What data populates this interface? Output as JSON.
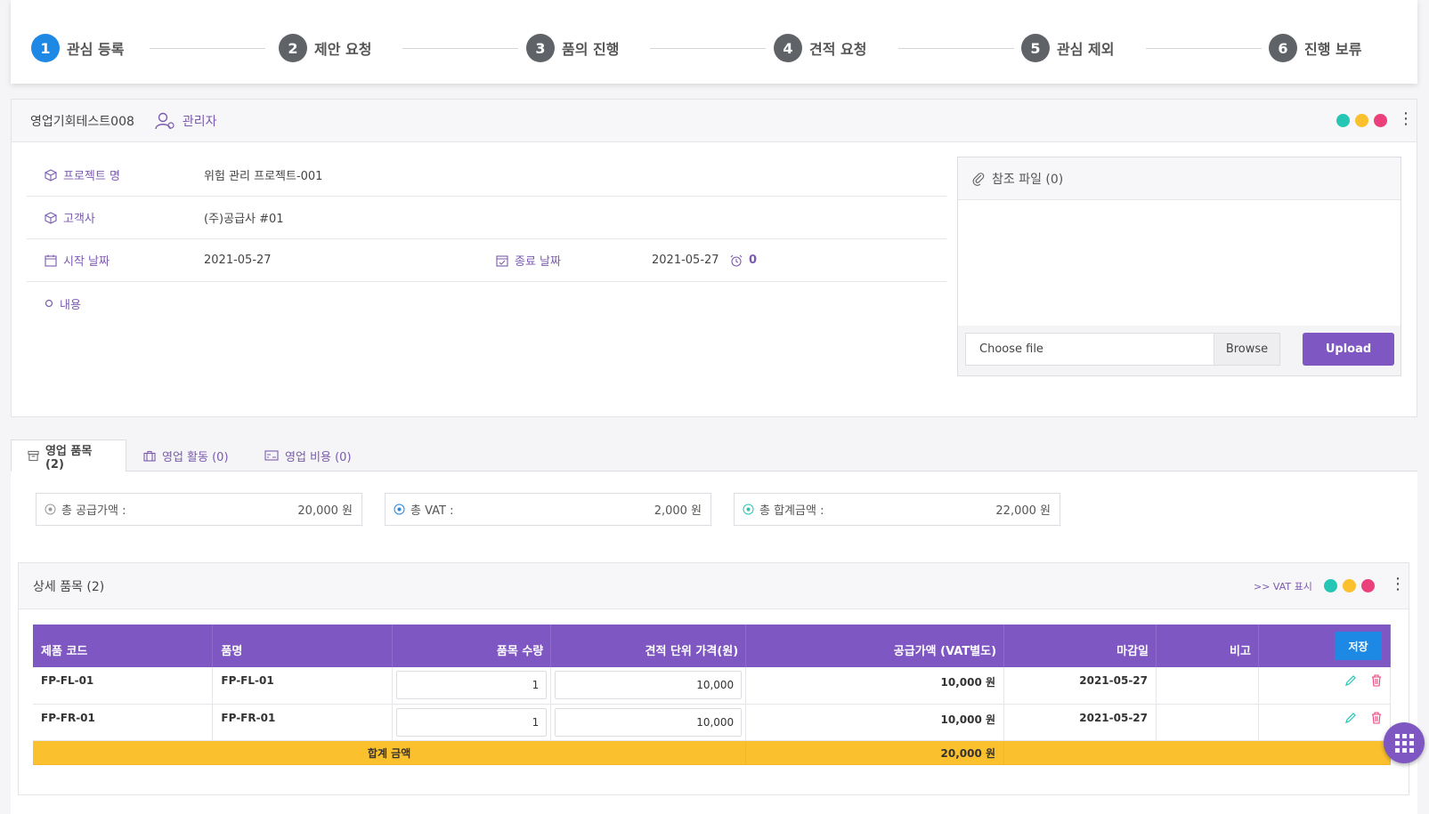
{
  "steps": [
    {
      "num": "1",
      "label": "관심 등록",
      "active": true
    },
    {
      "num": "2",
      "label": "제안 요청"
    },
    {
      "num": "3",
      "label": "품의 진행"
    },
    {
      "num": "4",
      "label": "견적 요청"
    },
    {
      "num": "5",
      "label": "관심 제외"
    },
    {
      "num": "6",
      "label": "진행 보류"
    }
  ],
  "header": {
    "title": "영업기회테스트008",
    "manager": "관리자"
  },
  "status_colors": [
    "#26c6b5",
    "#fbc02d",
    "#ec407a"
  ],
  "fields": {
    "project_label": "프로젝트 명",
    "project_value": "위험 관리 프로젝트-001",
    "client_label": "고객사",
    "client_value": "(주)공급사 #01",
    "start_label": "시작 날짜",
    "start_value": "2021-05-27",
    "end_label": "종료 날짜",
    "end_value": "2021-05-27",
    "days_value": "0",
    "content_label": "내용"
  },
  "reference": {
    "title": "참조 파일 (0)",
    "choose": "Choose file",
    "browse": "Browse",
    "upload": "Upload"
  },
  "tabs": [
    {
      "label": "영업 품목 (2)"
    },
    {
      "label": "영업 활동 (0)"
    },
    {
      "label": "영업 비용 (0)"
    }
  ],
  "summary": [
    {
      "label": "총 공급가액 :",
      "value": "20,000 원"
    },
    {
      "label": "총 VAT :",
      "value": "2,000 원"
    },
    {
      "label": "총 합계금액 :",
      "value": "22,000 원"
    }
  ],
  "detail": {
    "title": "상세 품목 (2)",
    "vat_link": ">> VAT 표시",
    "save": "저장",
    "headers": [
      "제품 코드",
      "품명",
      "품목 수량",
      "견적 단위 가격(원)",
      "공급가액 (VAT별도)",
      "마감일",
      "비고"
    ],
    "rows": [
      {
        "code": "FP-FL-01",
        "name": "FP-FL-01",
        "qty": "1",
        "price": "10,000",
        "supply": "10,000 원",
        "due": "2021-05-27",
        "note": ""
      },
      {
        "code": "FP-FR-01",
        "name": "FP-FR-01",
        "qty": "1",
        "price": "10,000",
        "supply": "10,000 원",
        "due": "2021-05-27",
        "note": ""
      }
    ],
    "total_label": "합계 금액",
    "total_value": "20,000 원"
  }
}
